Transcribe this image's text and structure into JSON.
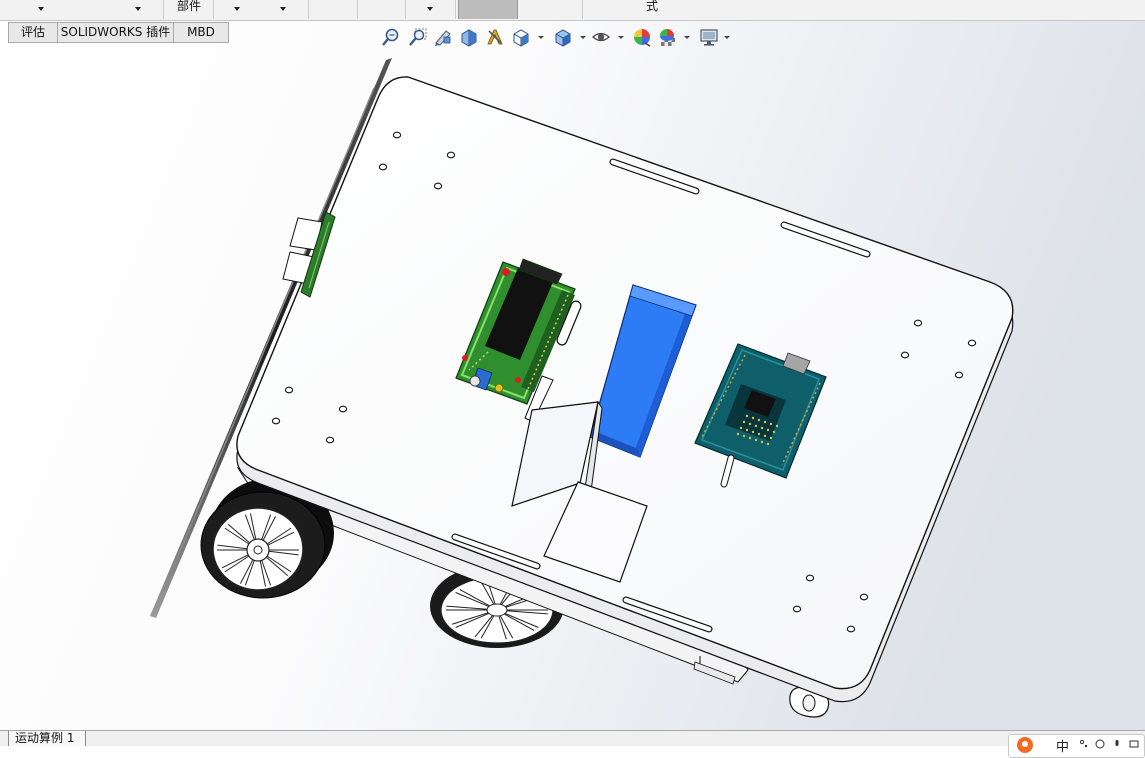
{
  "app": {
    "name": "SOLIDWORKS"
  },
  "top_toolbar": {
    "group_label": "部件",
    "right_label": "式"
  },
  "command_tabs": [
    {
      "label": "评估"
    },
    {
      "label": "SOLIDWORKS 插件"
    },
    {
      "label": "MBD"
    }
  ],
  "view_toolbar": {
    "icons": [
      {
        "icon": "zoom-to-fit-icon",
        "dropdown": false
      },
      {
        "icon": "zoom-to-area-icon",
        "dropdown": false
      },
      {
        "icon": "previous-view-icon",
        "dropdown": false
      },
      {
        "icon": "section-view-icon",
        "dropdown": false
      },
      {
        "icon": "dynamic-annotation-views-icon",
        "dropdown": false
      },
      {
        "icon": "view-orientation-icon",
        "dropdown": true
      },
      {
        "icon": "display-style-icon",
        "dropdown": true
      },
      {
        "icon": "hide-show-items-icon",
        "dropdown": true
      },
      {
        "icon": "edit-appearance-icon",
        "dropdown": false
      },
      {
        "icon": "apply-scene-icon",
        "dropdown": true
      },
      {
        "icon": "view-settings-icon",
        "dropdown": true
      }
    ]
  },
  "model": {
    "parts": [
      "chassis-plate",
      "lower-plate",
      "left-wheel",
      "rear-wheel",
      "caster-wheel",
      "ultrasonic-sensor",
      "microcontroller-board",
      "battery-pack",
      "shield-board",
      "mounting-bracket"
    ]
  },
  "status_bar": {
    "motion_study_tab": "运动算例 1"
  },
  "ime_bar": {
    "mode_label": "中"
  },
  "colors": {
    "viewport_light": "#ffffff",
    "viewport_dark": "#dde1e8",
    "battery": "#2e7cf5",
    "mcu_board": "#2f8f2f",
    "shield_board": "#0f5f6b",
    "tire": "#1a1a1a",
    "pressed_button": "#bcbcbc",
    "ime_logo": "#f36b21"
  }
}
